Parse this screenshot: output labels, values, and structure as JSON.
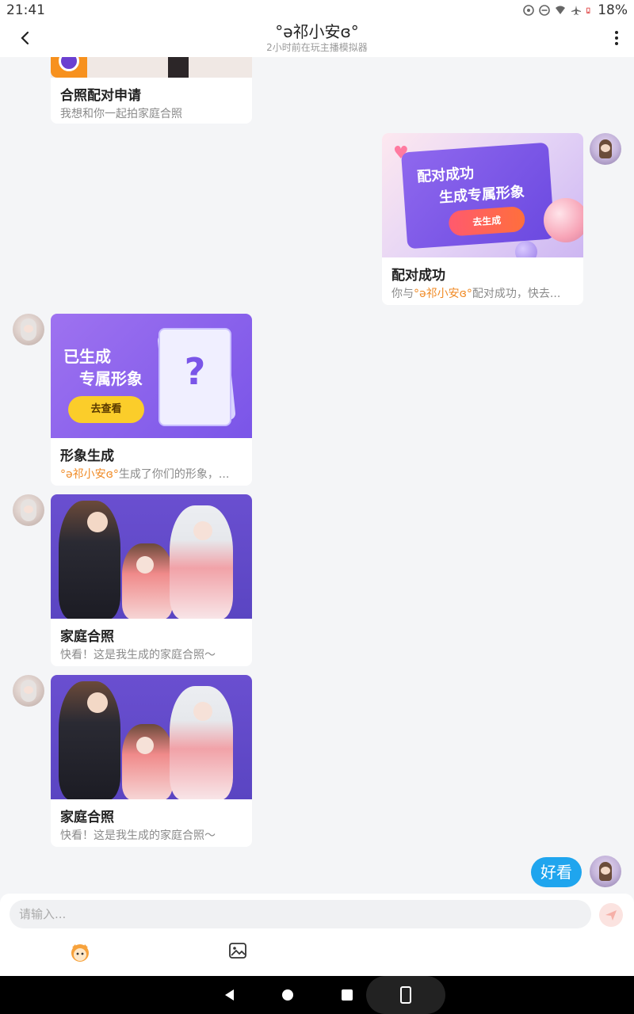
{
  "status_bar": {
    "time": "21:41",
    "battery": "18%"
  },
  "header": {
    "title": "°ə祁小安ɞ°",
    "subtitle": "2小时前在玩主播模拟器"
  },
  "messages": [
    {
      "type": "card",
      "side": "left",
      "title": "合照配对申请",
      "desc": "我想和你一起拍家庭合照"
    },
    {
      "type": "card",
      "side": "right",
      "title": "配对成功",
      "desc_prefix": "你与",
      "desc_name": "°ə祁小安ɞ°",
      "desc_suffix": "配对成功，快去...",
      "image_text": {
        "line1": "配对成功",
        "line2": "生成专属形象",
        "button": "去生成"
      }
    },
    {
      "type": "card",
      "side": "left",
      "title": "形象生成",
      "desc_name": "°ə祁小安ɞ°",
      "desc_suffix": "生成了你们的形象，...",
      "image_text": {
        "line1": "已生成",
        "line2": "专属形象",
        "button": "去查看"
      }
    },
    {
      "type": "card",
      "side": "left",
      "title": "家庭合照",
      "desc": "快看！这是我生成的家庭合照～"
    },
    {
      "type": "card",
      "side": "left",
      "title": "家庭合照",
      "desc": "快看！这是我生成的家庭合照～"
    },
    {
      "type": "text",
      "side": "right",
      "text": "好看"
    }
  ],
  "input": {
    "placeholder": "请输入..."
  },
  "colors": {
    "accent": "#1fa5ee",
    "highlight": "#f08a24",
    "background": "#f4f5f7"
  },
  "icons": {
    "back": "chevron-left-icon",
    "more": "more-vertical-icon",
    "send": "send-icon",
    "emoji": "mascot-emoji-icon",
    "image": "image-icon"
  }
}
